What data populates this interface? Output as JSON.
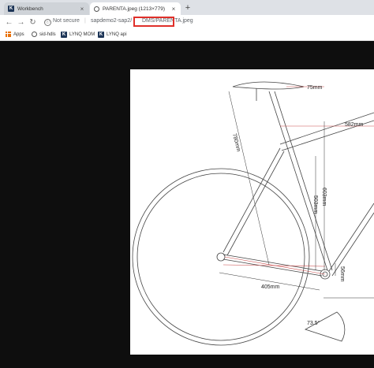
{
  "tabs": [
    {
      "title": "Workbench",
      "active": false,
      "icon": "k-logo-icon"
    },
    {
      "title": "PARENTA.jpeg (1213×779)",
      "active": true,
      "icon": "globe-icon"
    }
  ],
  "new_tab_label": "+",
  "toolbar": {
    "back": "←",
    "forward": "→",
    "reload": "↻",
    "info_icon": "ⓘ",
    "security_text": "Not secure",
    "separator": "|",
    "url_host": "sapdemo2-sap2/",
    "url_path": "DMS/",
    "url_file": "PARENTA.jpeg"
  },
  "bookmarks": [
    {
      "label": "Apps",
      "icon": "apps-grid-icon"
    },
    {
      "label": "sid-hdls",
      "icon": "globe-icon"
    },
    {
      "label": "LYNQ MOM",
      "icon": "k-logo-icon"
    },
    {
      "label": "LYNQ api",
      "icon": "k-logo-icon"
    }
  ],
  "drawing": {
    "dim_top_tube_small": "75mm",
    "dim_reach": "582mm",
    "dim_seat_tube_c": "780mm",
    "dim_stack_a": "503mm",
    "dim_stack_b": "603mm",
    "dim_bb_drop": "56mm",
    "dim_chainstay": "405mm",
    "dim_angle": "73.5°"
  }
}
